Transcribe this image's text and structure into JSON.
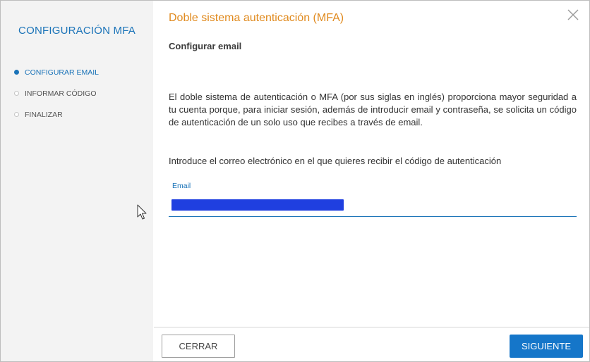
{
  "sidebar": {
    "title": "CONFIGURACIÓN MFA",
    "steps": [
      {
        "label": "CONFIGURAR EMAIL",
        "active": true
      },
      {
        "label": "INFORMAR CÓDIGO",
        "active": false
      },
      {
        "label": "FINALIZAR",
        "active": false
      }
    ]
  },
  "dialog": {
    "title": "Doble sistema autenticación (MFA)",
    "subtitle": "Configurar email",
    "description": "El doble sistema de autenticación o MFA (por sus siglas en inglés) proporciona mayor seguridad a tu cuenta porque, para iniciar sesión, además de introducir email y contraseña, se solicita un código de autenticación de un solo uso que recibes a través de email.",
    "instruction": "Introduce el correo electrónico en el que quieres recibir el código de autenticación",
    "close_icon": "close-icon"
  },
  "form": {
    "email_label": "Email"
  },
  "footer": {
    "cancel_label": "CERRAR",
    "next_label": "SIGUIENTE"
  },
  "colors": {
    "accent": "#1a73b8",
    "title": "#e08a1e",
    "primary_button": "#1576c9",
    "sidebar_bg": "#f3f3f3"
  }
}
